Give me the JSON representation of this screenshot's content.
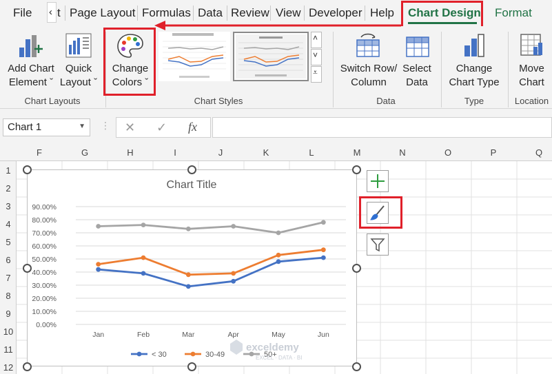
{
  "menu": {
    "items": [
      "File",
      "Page Layout",
      "Formulas",
      "Data",
      "Review",
      "View",
      "Developer",
      "Help",
      "Chart Design",
      "Format"
    ],
    "tab_partial": "t",
    "active": "Chart Design"
  },
  "ribbon": {
    "add_chart_element": [
      "Add Chart",
      "Element ˇ"
    ],
    "quick_layout": [
      "Quick",
      "Layout ˇ"
    ],
    "change_colors": [
      "Change",
      "Colors ˇ"
    ],
    "switch_row_column": [
      "Switch Row/",
      "Column"
    ],
    "select_data": [
      "Select",
      "Data"
    ],
    "change_chart_type": [
      "Change",
      "Chart Type"
    ],
    "move_chart": [
      "Move",
      "Chart"
    ],
    "groups": {
      "chart_layouts": "Chart Layouts",
      "chart_styles": "Chart Styles",
      "data": "Data",
      "type": "Type",
      "location": "Location"
    }
  },
  "formula_bar": {
    "name_box": "Chart 1",
    "cancel_symbol": "✕",
    "enter_symbol": "✓",
    "fx_symbol": "fx",
    "formula_value": ""
  },
  "grid": {
    "columns": [
      "F",
      "G",
      "H",
      "I",
      "J",
      "K",
      "L",
      "M",
      "N",
      "O",
      "P",
      "Q"
    ],
    "rows": [
      "1",
      "2",
      "3",
      "4",
      "5",
      "6",
      "7",
      "8",
      "9",
      "10",
      "11",
      "12"
    ]
  },
  "chart_data": {
    "type": "line",
    "title": "Chart Title",
    "categories": [
      "Jan",
      "Feb",
      "Mar",
      "Apr",
      "May",
      "Jun"
    ],
    "y_ticks": [
      "0.00%",
      "10.00%",
      "20.00%",
      "30.00%",
      "40.00%",
      "50.00%",
      "60.00%",
      "70.00%",
      "80.00%",
      "90.00%"
    ],
    "ylim": [
      0,
      0.9
    ],
    "grid": true,
    "legend_position": "bottom",
    "series": [
      {
        "name": "< 30",
        "color": "#4472c4",
        "values": [
          0.42,
          0.39,
          0.29,
          0.33,
          0.48,
          0.51
        ]
      },
      {
        "name": "30-49",
        "color": "#ed7d31",
        "values": [
          0.46,
          0.51,
          0.38,
          0.39,
          0.53,
          0.57
        ]
      },
      {
        "name": "50+",
        "color": "#a5a5a5",
        "values": [
          0.75,
          0.76,
          0.73,
          0.75,
          0.7,
          0.78
        ]
      }
    ]
  },
  "watermark": {
    "brand": "exceldemy",
    "tagline": "EXCEL · DATA · BI"
  },
  "colors": {
    "highlight": "#e0202a",
    "active_tab": "#217346",
    "format_tab": "#217346"
  }
}
